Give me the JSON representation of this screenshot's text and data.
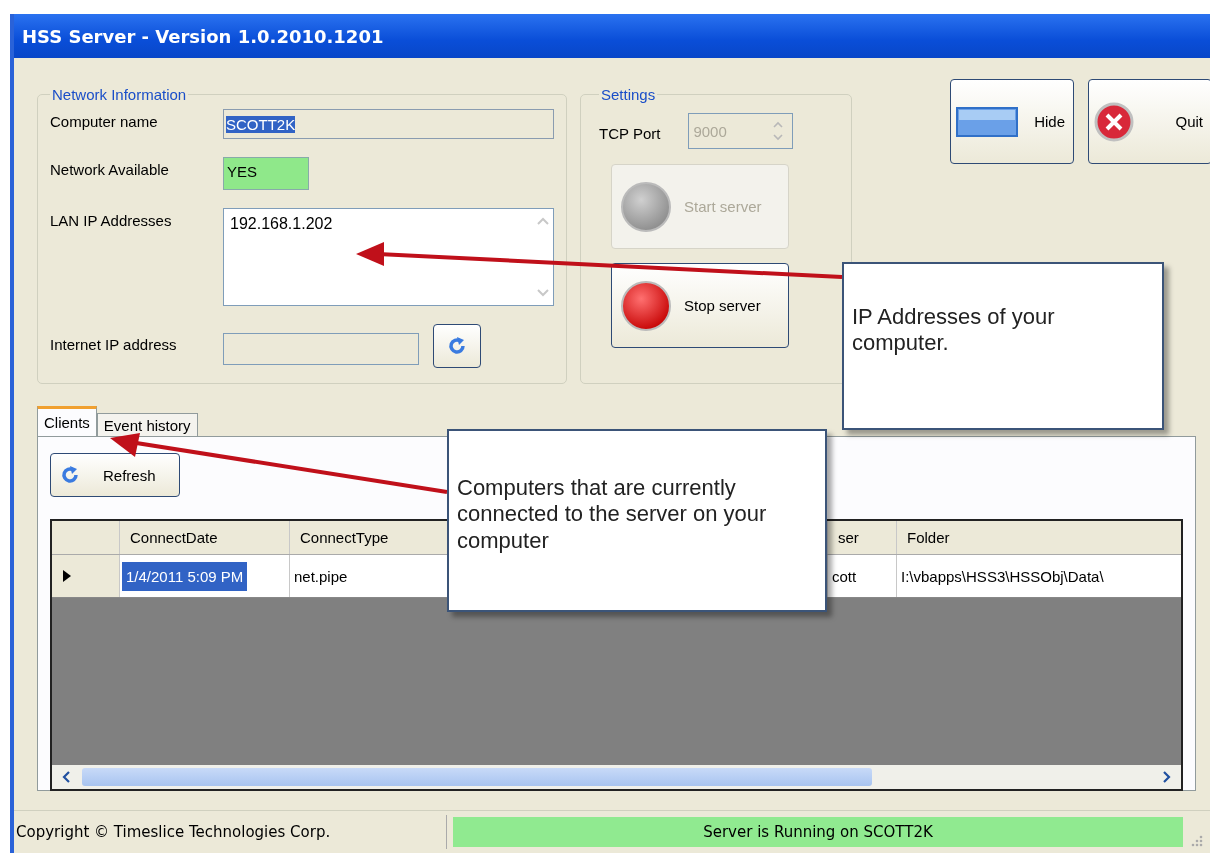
{
  "window": {
    "title": "HSS Server - Version 1.0.2010.1201"
  },
  "network_information": {
    "legend": "Network Information",
    "computer_name": {
      "label": "Computer name",
      "value": "SCOTT2K"
    },
    "network_available": {
      "label": "Network Available",
      "value": "YES"
    },
    "lan_ip_addresses": {
      "label": "LAN IP Addresses",
      "value": "192.168.1.202"
    },
    "internet_ip_address": {
      "label": "Internet IP address"
    }
  },
  "settings": {
    "legend": "Settings",
    "tcp_port": {
      "label": "TCP Port",
      "value": "9000",
      "disabled": true
    },
    "buttons": [
      {
        "label": "Start server",
        "kind": "start",
        "disabled": true
      },
      {
        "label": "Stop server",
        "kind": "stop",
        "disabled": false
      }
    ]
  },
  "window_buttons": [
    {
      "label": "Hide",
      "kind": "hide"
    },
    {
      "label": "Quit",
      "kind": "quit"
    }
  ],
  "tabs": [
    {
      "label": "Clients",
      "selected": true
    },
    {
      "label": "Event history",
      "selected": false
    }
  ],
  "clients": {
    "refresh_button": "Refresh",
    "table": {
      "columns": [
        "ConnectDate",
        "ConnectType",
        "ser",
        "Folder"
      ],
      "rows": [
        {
          "selected": true,
          "cells": [
            "1/4/2011 5:09 PM",
            "net.pipe",
            "cott",
            "I:\\vbapps\\HSS3\\HSSObj\\Data\\"
          ]
        }
      ]
    }
  },
  "callouts": [
    {
      "text": "IP Addresses of your computer."
    },
    {
      "text": "Computers that are currently connected to the server on your computer"
    }
  ],
  "status_bar": {
    "copyright": "Copyright © Timeslice Technologies Corp.",
    "status": "Server is Running on SCOTT2K"
  }
}
